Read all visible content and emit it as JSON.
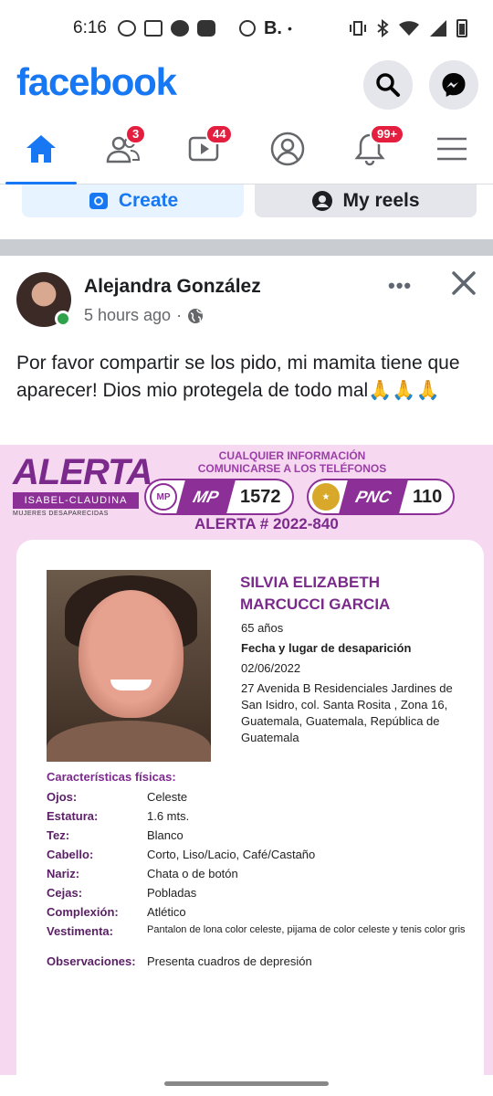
{
  "status_bar": {
    "time": "6:16",
    "b_label": "B.",
    "left_icons": [
      "whatsapp-icon",
      "news-icon",
      "facebook-icon",
      "youtube-icon"
    ],
    "right_icons": [
      "alarm-icon",
      "vibrate-icon",
      "bluetooth-icon",
      "wifi-icon",
      "signal-icon",
      "battery-icon"
    ]
  },
  "header": {
    "logo": "facebook",
    "brand_color": "#1877f2"
  },
  "nav": {
    "items": [
      {
        "name": "home",
        "badge": ""
      },
      {
        "name": "friends",
        "badge": "3"
      },
      {
        "name": "video",
        "badge": "44"
      },
      {
        "name": "profile",
        "badge": ""
      },
      {
        "name": "notifications",
        "badge": "99+"
      },
      {
        "name": "menu",
        "badge": ""
      }
    ]
  },
  "shortcuts": {
    "create_label": "Create",
    "reels_label": "My reels"
  },
  "post": {
    "author": "Alejandra González",
    "time": "5 hours ago",
    "text": "Por favor compartir se los pido, mi mamita tiene que aparecer! Dios mio protegela de todo mal🙏🙏🙏"
  },
  "poster": {
    "logo_word": "ALERTA",
    "logo_sub": "ISABEL-CLAUDINA",
    "logo_sub2": "MUJERES DESAPARECIDAS",
    "info_line1": "CUALQUIER INFORMACIÓN",
    "info_line2": "COMUNICARSE A LOS TELÉFONOS",
    "mp_label": "MP",
    "mp_seal": "MP",
    "mp_number": "1572",
    "pnc_label": "PNC",
    "pnc_number": "110",
    "alert_number": "ALERTA # 2022-840",
    "person": {
      "name_line1": "SILVIA ELIZABETH",
      "name_line2": "MARCUCCI GARCIA",
      "age": "65 años",
      "date_place_label": "Fecha y lugar de desaparición",
      "date": "02/06/2022",
      "address": "27 Avenida B Residenciales Jardines de San Isidro, col. Santa Rosita , Zona 16, Guatemala, Guatemala, República de Guatemala"
    },
    "characteristics_title": "Características físicas:",
    "characteristics": [
      {
        "key": "Ojos:",
        "value": "Celeste"
      },
      {
        "key": "Estatura:",
        "value": "1.6 mts."
      },
      {
        "key": "Tez:",
        "value": "Blanco"
      },
      {
        "key": "Cabello:",
        "value": "Corto, Liso/Lacio, Café/Castaño"
      },
      {
        "key": "Nariz:",
        "value": "Chata o de botón"
      },
      {
        "key": "Cejas:",
        "value": "Pobladas"
      },
      {
        "key": "Complexión:",
        "value": "Atlético"
      },
      {
        "key": "Vestimenta:",
        "value": "Pantalon de lona color celeste, pijama de color celeste y tenis color gris"
      },
      {
        "key": "Observaciones:",
        "value": "Presenta cuadros de depresión"
      }
    ]
  }
}
